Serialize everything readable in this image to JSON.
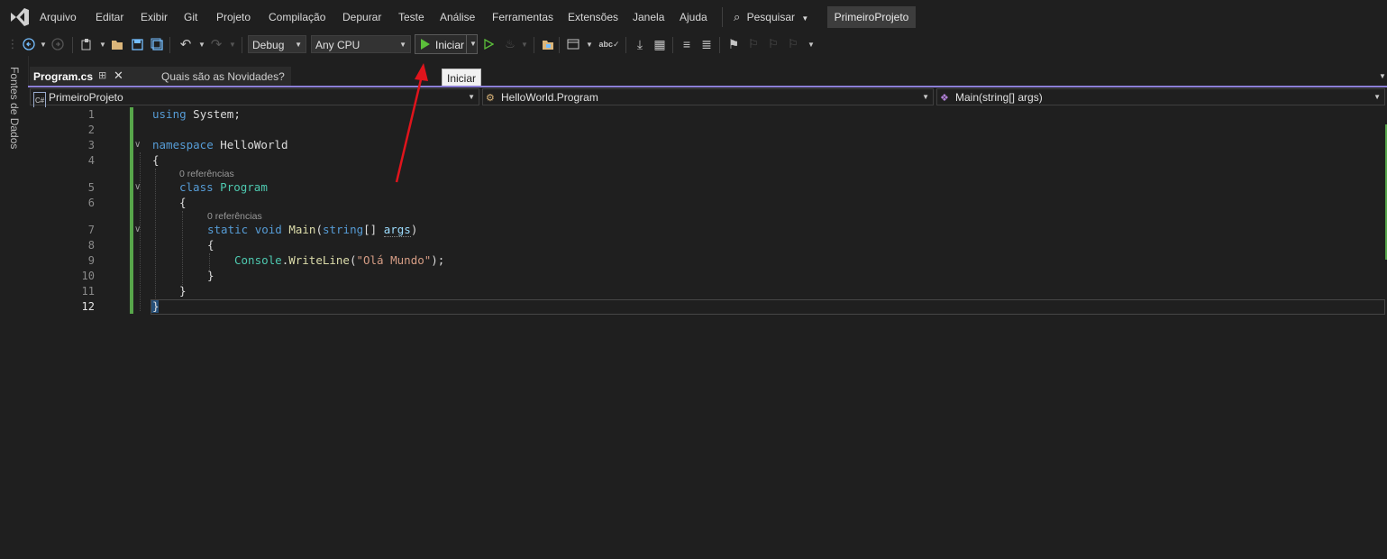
{
  "menu": {
    "items": [
      "Arquivo",
      "Editar",
      "Exibir",
      "Git",
      "Projeto",
      "Compilação",
      "Depurar",
      "Teste",
      "Análise",
      "Ferramentas",
      "Extensões",
      "Janela",
      "Ajuda"
    ],
    "search_label": "Pesquisar",
    "project_name": "PrimeiroProjeto"
  },
  "toolbar": {
    "configuration": "Debug",
    "platform": "Any CPU",
    "start_label": "Iniciar",
    "tooltip": "Iniciar"
  },
  "side_panel": {
    "label": "Fontes de Dados"
  },
  "tabs": [
    {
      "label": "Program.cs",
      "active": true
    },
    {
      "label": "Quais são as Novidades?",
      "active": false
    }
  ],
  "navbar": {
    "project": "PrimeiroProjeto",
    "type": "HelloWorld.Program",
    "member": "Main(string[] args)"
  },
  "editor": {
    "line_numbers": [
      "1",
      "2",
      "3",
      "4",
      "5",
      "6",
      "7",
      "8",
      "9",
      "10",
      "11",
      "12"
    ],
    "current_line": "12",
    "codelens": [
      "0 referências",
      "0 referências"
    ],
    "code": {
      "l1_kw": "using",
      "l1_rest": " System;",
      "l3_kw": "namespace",
      "l3_rest": " HelloWorld",
      "l4": "{",
      "l5_kw": "class",
      "l5_type": "Program",
      "l6": "{",
      "l7_kw1": "static",
      "l7_kw2": "void",
      "l7_fn": "Main",
      "l7_open": "(",
      "l7_kw3": "string",
      "l7_mid": "[] ",
      "l7_param": "args",
      "l7_close": ")",
      "l8": "{",
      "l9_type": "Console",
      "l9_dot": ".",
      "l9_fn": "WriteLine",
      "l9_open": "(",
      "l9_str": "\"Olá Mundo\"",
      "l9_close": ");",
      "l10": "}",
      "l11": "}",
      "l12": "}"
    }
  },
  "colors": {
    "accent_tab": "#8c7fd6",
    "play_green": "#5bbf3a",
    "change_bar": "#57a64a",
    "annotation_arrow": "#e0141c"
  }
}
